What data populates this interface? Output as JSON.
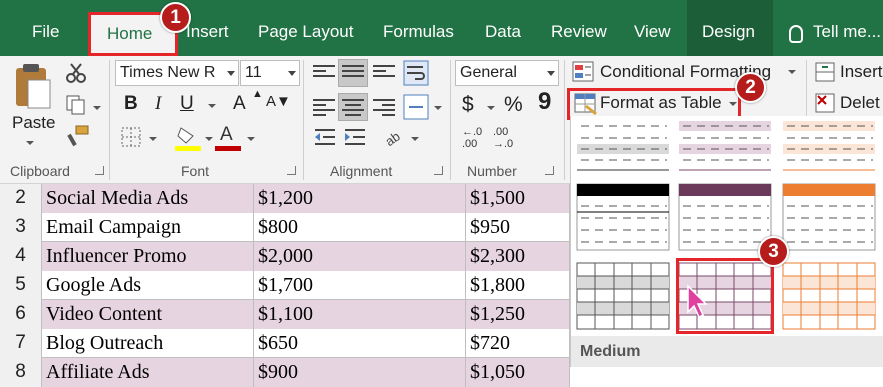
{
  "tabs": {
    "file": "File",
    "home": "Home",
    "insert": "Insert",
    "page_layout": "Page Layout",
    "formulas": "Formulas",
    "data": "Data",
    "review": "Review",
    "view": "View",
    "design": "Design",
    "tell_me": "Tell me..."
  },
  "clipboard": {
    "paste": "Paste",
    "label": "Clipboard"
  },
  "font": {
    "name": "Times New R",
    "size": "11",
    "label": "Font",
    "bold": "B",
    "italic": "I",
    "underline": "U",
    "grow": "A",
    "font_color_letter": "A",
    "fill_color": "#ffff00",
    "text_color": "#c00000"
  },
  "alignment": {
    "label": "Alignment"
  },
  "number": {
    "format": "General",
    "currency": "$",
    "percent": "%",
    "comma": "9",
    "inc_decimal": ".0\n.00",
    "label": "Number",
    "inc_top": "←.0",
    "inc_bottom": ".00",
    "dec_top": ".00",
    "dec_bottom": "→.0"
  },
  "styles": {
    "conditional": "Conditional Formatting",
    "format_table": "Format as Table"
  },
  "cells": {
    "insert": "Insert",
    "delete": "Delet"
  },
  "gallery": {
    "section_label": "Medium"
  },
  "rows": [
    {
      "num": "2",
      "a": "Social Media Ads",
      "b": "$1,200",
      "c": "$1,500"
    },
    {
      "num": "3",
      "a": "Email Campaign",
      "b": "$800",
      "c": "$950"
    },
    {
      "num": "4",
      "a": "Influencer Promo",
      "b": "$2,000",
      "c": "$2,300"
    },
    {
      "num": "5",
      "a": "Google Ads",
      "b": "$1,700",
      "c": "$1,800"
    },
    {
      "num": "6",
      "a": "Video Content",
      "b": "$1,100",
      "c": "$1,250"
    },
    {
      "num": "7",
      "a": "Blog Outreach",
      "b": "$650",
      "c": "$720"
    },
    {
      "num": "8",
      "a": "Affiliate Ads",
      "b": "$900",
      "c": "$1,050"
    }
  ],
  "callouts": {
    "one": "1",
    "two": "2",
    "three": "3"
  },
  "colors": {
    "excel_green": "#217346",
    "highlight_red": "#e4262b",
    "row_shade": "#e6d5e0"
  }
}
